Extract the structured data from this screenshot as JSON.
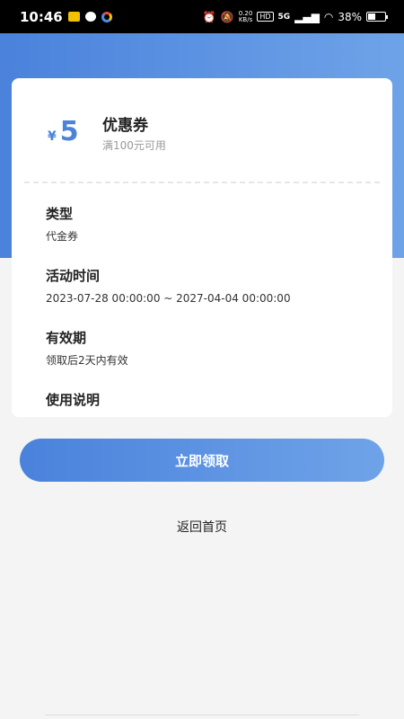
{
  "status_bar": {
    "time": "10:46",
    "net_speed_value": "0.20",
    "net_speed_unit": "KB/s",
    "hd": "HD",
    "signal": "5G",
    "battery": "38%"
  },
  "coupon": {
    "currency": "¥",
    "amount": "5",
    "title": "优惠券",
    "condition": "满100元可用"
  },
  "info": [
    {
      "label": "类型",
      "value": "代金券"
    },
    {
      "label": "活动时间",
      "value": "2023-07-28 00:00:00 ~ 2027-04-04 00:00:00"
    },
    {
      "label": "有效期",
      "value": "领取后2天内有效"
    },
    {
      "label": "使用说明",
      "value": ""
    }
  ],
  "actions": {
    "claim": "立即领取",
    "back_home": "返回首页"
  },
  "colors": {
    "accent": "#4a82dc",
    "accent_light": "#6fa3e8"
  }
}
